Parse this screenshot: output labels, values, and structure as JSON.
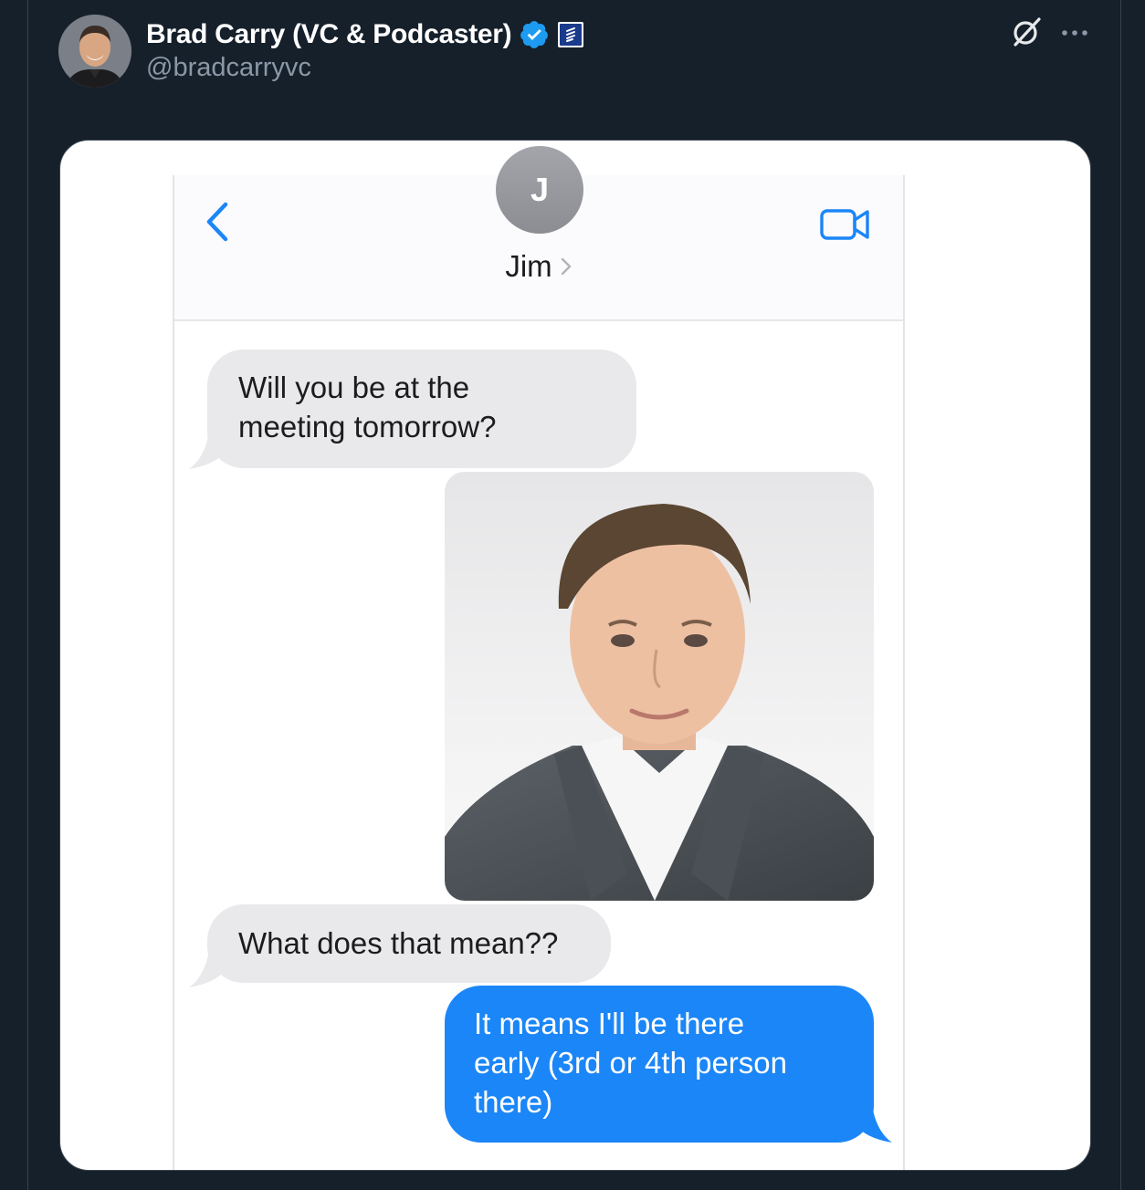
{
  "tweet": {
    "author_name": "Brad Carry (VC & Podcaster)",
    "handle": "@bradcarryvc",
    "icons": {
      "avatar": "profile-photo",
      "verified": "verified-badge-icon",
      "affiliate": "affiliate-badge-icon",
      "grok": "grok-icon",
      "more": "more-options-icon"
    },
    "colors": {
      "background": "#15202b",
      "name": "#ffffff",
      "handle": "#8b98a5",
      "verified": "#1d9bf0"
    }
  },
  "screenshot": {
    "contact": {
      "initial": "J",
      "name": "Jim"
    },
    "icons": {
      "back": "chevron-left-icon",
      "video": "video-camera-icon",
      "contact_chevron": "chevron-right-icon"
    },
    "messages": [
      {
        "direction": "incoming",
        "type": "text",
        "lines": [
          "Will you be at the",
          "meeting tomorrow?"
        ]
      },
      {
        "direction": "outgoing",
        "type": "image",
        "subject": "portrait of a man in a grey suit"
      },
      {
        "direction": "incoming",
        "type": "text",
        "lines": [
          "What does that mean??"
        ]
      },
      {
        "direction": "outgoing",
        "type": "text",
        "lines": [
          "It means I'll be there",
          "early (3rd or 4th person",
          "there)"
        ]
      }
    ],
    "colors": {
      "incoming_bubble": "#e9e9eb",
      "outgoing_bubble": "#1b86f7",
      "accent": "#1b86f7"
    }
  }
}
